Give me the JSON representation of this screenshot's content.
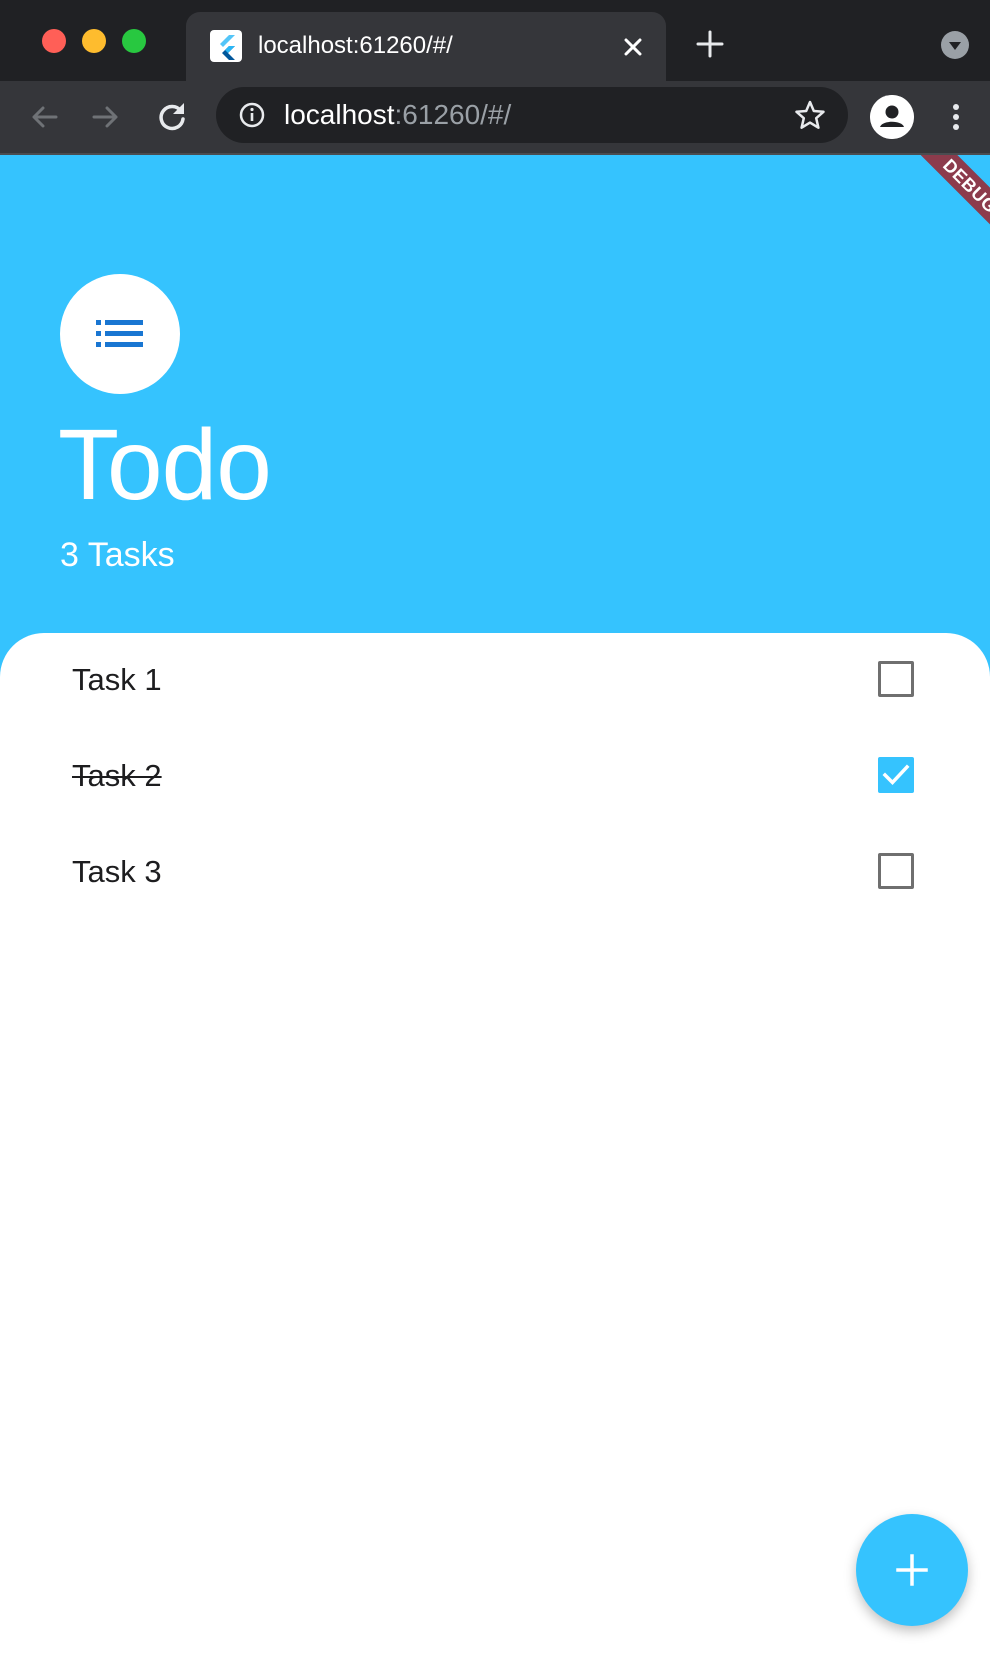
{
  "browser": {
    "tab": {
      "title": "localhost:61260/#/",
      "favicon": "flutter-logo-icon"
    },
    "address": {
      "host": "localhost",
      "rest": ":61260/#/"
    },
    "icons": {
      "back": "arrow-left-icon",
      "forward": "arrow-right-icon",
      "reload": "reload-icon",
      "info": "info-icon",
      "bookmark": "star-icon",
      "profile": "person-icon",
      "menu": "kebab-menu-icon"
    }
  },
  "app": {
    "debug_banner": "DEBUG",
    "header_icon": "list-icon",
    "title": "Todo",
    "subtitle": "3 Tasks",
    "accent_color": "#35c3fe",
    "tasks": [
      {
        "label": "Task 1",
        "done": false
      },
      {
        "label": "Task 2",
        "done": true
      },
      {
        "label": "Task 3",
        "done": false
      }
    ],
    "fab_icon": "plus-icon"
  }
}
